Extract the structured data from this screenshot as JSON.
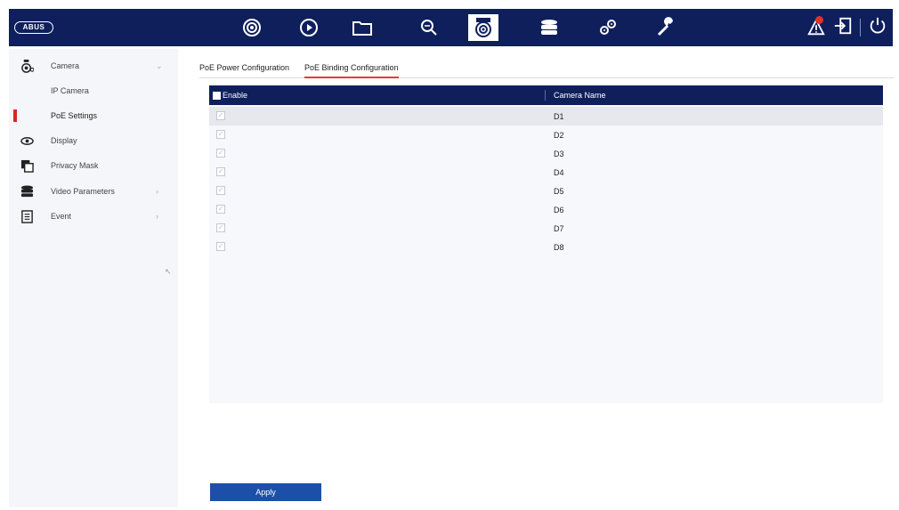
{
  "brand": {
    "logo_text": "ABUS"
  },
  "colors": {
    "topbar": "#0e1f5c",
    "accent": "#d7262b",
    "button": "#1c4fa8"
  },
  "top_nav": [
    {
      "icon": "live-view-icon"
    },
    {
      "icon": "playback-icon"
    },
    {
      "icon": "file-manager-icon"
    },
    {
      "icon": "smart-search-icon"
    },
    {
      "icon": "camera-icon",
      "active": true
    },
    {
      "icon": "storage-icon"
    },
    {
      "icon": "system-settings-icon"
    },
    {
      "icon": "maintenance-icon"
    }
  ],
  "top_right": [
    "alarm-icon",
    "logout-icon",
    "power-icon"
  ],
  "sidebar": {
    "items": [
      {
        "label": "Camera",
        "icon": "camera-icon",
        "chevron": "⌄"
      },
      {
        "label": "IP Camera"
      },
      {
        "label": "PoE Settings",
        "active": true
      },
      {
        "label": "Display",
        "icon": "display-eye-icon"
      },
      {
        "label": "Privacy Mask",
        "icon": "privacy-mask-icon"
      },
      {
        "label": "Video Parameters",
        "icon": "video-params-icon",
        "chevron": "›"
      },
      {
        "label": "Event",
        "icon": "event-icon",
        "chevron": "›"
      }
    ]
  },
  "tabs": [
    {
      "label": "PoE Power Configuration"
    },
    {
      "label": "PoE Binding Configuration",
      "active": true
    }
  ],
  "table": {
    "headers": {
      "enable": "Enable",
      "camera_name": "Camera Name"
    },
    "rows": [
      {
        "name": "D1",
        "checked": true
      },
      {
        "name": "D2",
        "checked": true
      },
      {
        "name": "D3",
        "checked": true
      },
      {
        "name": "D4",
        "checked": true
      },
      {
        "name": "D5",
        "checked": true
      },
      {
        "name": "D6",
        "checked": true
      },
      {
        "name": "D7",
        "checked": true
      },
      {
        "name": "D8",
        "checked": true
      }
    ]
  },
  "actions": {
    "apply_label": "Apply"
  }
}
